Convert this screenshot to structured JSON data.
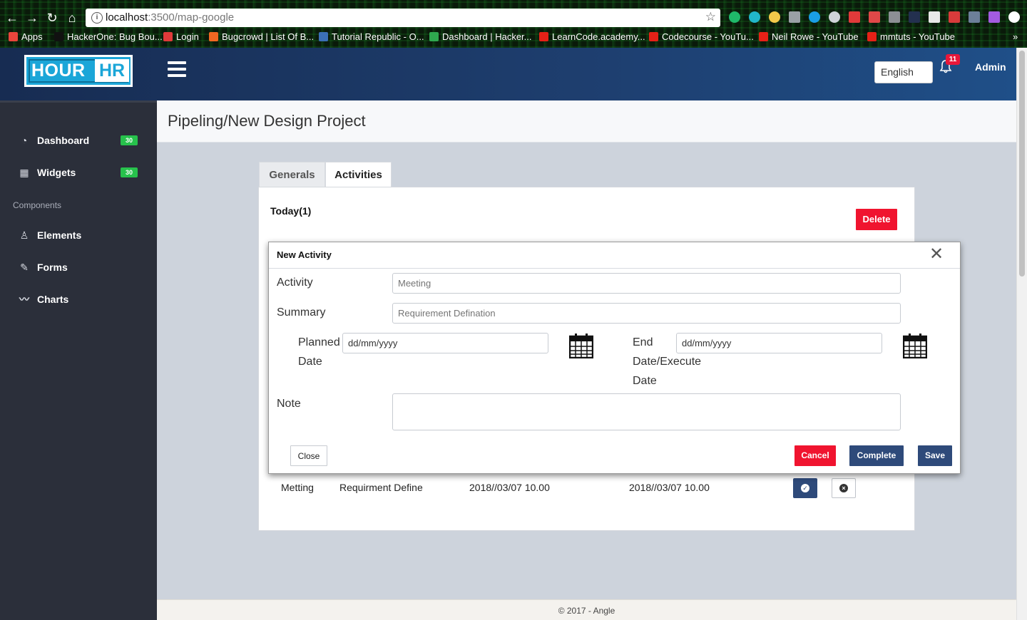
{
  "browser": {
    "url_host": "localhost",
    "url_path": ":3500/map-google",
    "bookmarks": [
      {
        "label": "Apps",
        "color": "#e8453c"
      },
      {
        "label": "HackerOne: Bug Bou...",
        "color": "#111111"
      },
      {
        "label": "Login",
        "color": "#e03a3a"
      },
      {
        "label": "Bugcrowd | List Of B...",
        "color": "#f26822"
      },
      {
        "label": "Tutorial Republic - O...",
        "color": "#3b6fb6"
      },
      {
        "label": "Dashboard | Hacker...",
        "color": "#2fa84f"
      },
      {
        "label": "LearnCode.academy...",
        "color": "#e62117"
      },
      {
        "label": "Codecourse - YouTu...",
        "color": "#e62117"
      },
      {
        "label": "Neil Rowe - YouTube",
        "color": "#e62117"
      },
      {
        "label": "mmtuts - YouTube",
        "color": "#e62117"
      }
    ],
    "overflow_label": "»"
  },
  "header": {
    "logo_left": "HOUR",
    "logo_right": "HR",
    "language": "English",
    "notification_count": "11",
    "user": "Admin"
  },
  "sidebar": {
    "items": [
      {
        "label": "Dashboard",
        "icon": "gauge-icon",
        "glyph": "◔",
        "badge": "30"
      },
      {
        "label": "Widgets",
        "icon": "grid-icon",
        "glyph": "▦",
        "badge": "30"
      }
    ],
    "heading": "Components",
    "components": [
      {
        "label": "Elements",
        "icon": "chess-pawn-icon",
        "glyph": "♙"
      },
      {
        "label": "Forms",
        "icon": "edit-icon",
        "glyph": "✎"
      },
      {
        "label": "Charts",
        "icon": "chart-line-icon",
        "glyph": "〰"
      }
    ]
  },
  "page": {
    "title": "Pipeling/New Design Project",
    "tabs": [
      "Generals",
      "Activities"
    ],
    "today_label": "Today(1)",
    "delete_label": "Delete",
    "row": {
      "activity": "Metting",
      "summary": "Requirment Define",
      "planned": "2018//03/07 10.00",
      "end": "2018//03/07 10.00"
    }
  },
  "modal": {
    "title": "New Activity",
    "close_glyph": "✕",
    "activity_label": "Activity",
    "activity_placeholder": "Meeting",
    "summary_label": "Summary",
    "summary_placeholder": "Requirement Defination",
    "planned_label_1": "Planned",
    "planned_label_2": "Date",
    "planned_value": "dd/mm/yyyy",
    "end_label_1": "End",
    "end_label_2": "Date/Execute",
    "end_label_3": "Date",
    "end_value": "dd/mm/yyyy",
    "note_label": "Note",
    "close_btn": "Close",
    "cancel_btn": "Cancel",
    "complete_btn": "Complete",
    "save_btn": "Save"
  },
  "footer": "© 2017 - Angle",
  "colors": {
    "header_start": "#172c52",
    "header_end": "#1f4f88",
    "sidebar": "#2b2f3a",
    "badge_green": "#27c24c",
    "danger": "#f0142f",
    "primary": "#2e4a7a"
  }
}
